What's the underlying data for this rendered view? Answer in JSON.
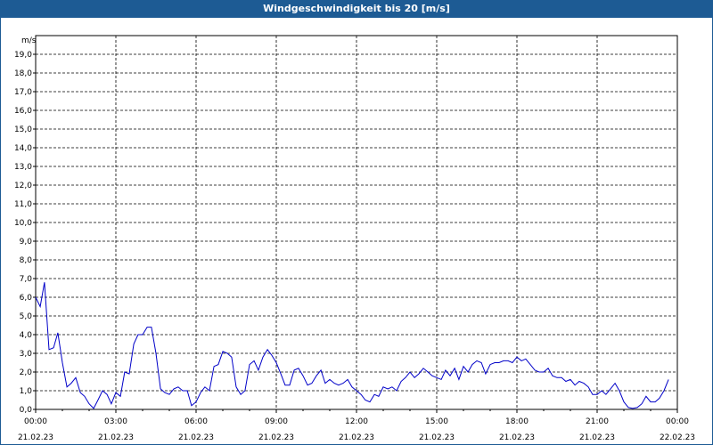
{
  "window": {
    "title": "Windgeschwindigkeit bis 20 [m/s]"
  },
  "colors": {
    "titlebar": "#1d5b94",
    "series": "#0000c8",
    "grid": "#000000"
  },
  "chart_data": {
    "type": "line",
    "title": "Windgeschwindigkeit bis 20 [m/s]",
    "ylabel": "m/s",
    "xlabel": "",
    "ylim": [
      0,
      20
    ],
    "xlim_hours": [
      0,
      24
    ],
    "y_ticks": [
      "0,0",
      "1,0",
      "2,0",
      "3,0",
      "4,0",
      "5,0",
      "6,0",
      "7,0",
      "8,0",
      "9,0",
      "10,0",
      "11,0",
      "12,0",
      "13,0",
      "14,0",
      "15,0",
      "16,0",
      "17,0",
      "18,0",
      "19,0"
    ],
    "x_ticks": [
      {
        "time": "00:00",
        "date": "21.02.23"
      },
      {
        "time": "03:00",
        "date": "21.02.23"
      },
      {
        "time": "06:00",
        "date": "21.02.23"
      },
      {
        "time": "09:00",
        "date": "21.02.23"
      },
      {
        "time": "12:00",
        "date": "21.02.23"
      },
      {
        "time": "15:00",
        "date": "21.02.23"
      },
      {
        "time": "18:00",
        "date": "21.02.23"
      },
      {
        "time": "21:00",
        "date": "21.02.23"
      },
      {
        "time": "00:00",
        "date": "22.02.23"
      }
    ],
    "grid": true,
    "x": [
      0.0,
      0.17,
      0.33,
      0.5,
      0.67,
      0.83,
      1.0,
      1.17,
      1.33,
      1.5,
      1.67,
      1.83,
      2.0,
      2.17,
      2.33,
      2.5,
      2.67,
      2.83,
      3.0,
      3.17,
      3.33,
      3.5,
      3.67,
      3.83,
      4.0,
      4.17,
      4.33,
      4.5,
      4.67,
      4.83,
      5.0,
      5.17,
      5.33,
      5.5,
      5.67,
      5.83,
      6.0,
      6.17,
      6.33,
      6.5,
      6.67,
      6.83,
      7.0,
      7.17,
      7.33,
      7.5,
      7.67,
      7.83,
      8.0,
      8.17,
      8.33,
      8.5,
      8.67,
      8.83,
      9.0,
      9.17,
      9.33,
      9.5,
      9.67,
      9.83,
      10.0,
      10.17,
      10.33,
      10.5,
      10.67,
      10.83,
      11.0,
      11.17,
      11.33,
      11.5,
      11.67,
      11.83,
      12.0,
      12.17,
      12.33,
      12.5,
      12.67,
      12.83,
      13.0,
      13.17,
      13.33,
      13.5,
      13.67,
      13.83,
      14.0,
      14.17,
      14.33,
      14.5,
      14.67,
      14.83,
      15.0,
      15.17,
      15.33,
      15.5,
      15.67,
      15.83,
      16.0,
      16.17,
      16.33,
      16.5,
      16.67,
      16.83,
      17.0,
      17.17,
      17.33,
      17.5,
      17.67,
      17.83,
      18.0,
      18.17,
      18.33,
      18.5,
      18.67,
      18.83,
      19.0,
      19.17,
      19.33,
      19.5,
      19.67,
      19.83,
      20.0,
      20.17,
      20.33,
      20.5,
      20.67,
      20.83,
      21.0,
      21.17,
      21.33,
      21.5,
      21.67,
      21.83,
      22.0,
      22.17,
      22.33,
      22.5,
      22.67,
      22.83,
      23.0,
      23.17,
      23.33,
      23.5,
      23.67,
      23.83
    ],
    "series": [
      {
        "values": [
          6.0,
          5.5,
          6.8,
          3.2,
          3.3,
          4.1,
          2.5,
          1.2,
          1.4,
          1.7,
          0.9,
          0.7,
          0.3,
          0.05,
          0.5,
          1.0,
          0.8,
          0.3,
          0.9,
          0.7,
          2.0,
          1.9,
          3.5,
          4.0,
          4.0,
          4.4,
          4.4,
          3.0,
          1.1,
          0.9,
          0.8,
          1.1,
          1.2,
          1.0,
          1.0,
          0.2,
          0.4,
          0.9,
          1.2,
          1.0,
          2.3,
          2.4,
          3.1,
          3.0,
          2.8,
          1.2,
          0.8,
          1.0,
          2.4,
          2.6,
          2.1,
          2.8,
          3.2,
          2.9,
          2.5,
          1.9,
          1.3,
          1.3,
          2.1,
          2.2,
          1.8,
          1.3,
          1.4,
          1.8,
          2.1,
          1.4,
          1.6,
          1.4,
          1.3,
          1.4,
          1.6,
          1.2,
          1.0,
          0.8,
          0.5,
          0.4,
          0.8,
          0.7,
          1.2,
          1.1,
          1.2,
          1.0,
          1.5,
          1.7,
          2.0,
          1.7,
          1.9,
          2.2,
          2.0,
          1.8,
          1.7,
          1.6,
          2.1,
          1.8,
          2.2,
          1.6,
          2.3,
          2.0,
          2.4,
          2.6,
          2.5,
          1.9,
          2.4,
          2.5,
          2.5,
          2.6,
          2.6,
          2.5,
          2.8,
          2.6,
          2.7,
          2.4,
          2.1,
          2.0,
          2.0,
          2.2,
          1.8,
          1.7,
          1.7,
          1.5,
          1.6,
          1.3,
          1.5,
          1.4,
          1.2,
          0.8,
          0.8,
          1.0,
          0.8,
          1.1,
          1.4,
          1.0,
          0.4,
          0.1,
          0.05,
          0.1,
          0.3,
          0.7,
          0.4,
          0.4,
          0.6,
          1.0,
          1.6
        ]
      }
    ]
  }
}
